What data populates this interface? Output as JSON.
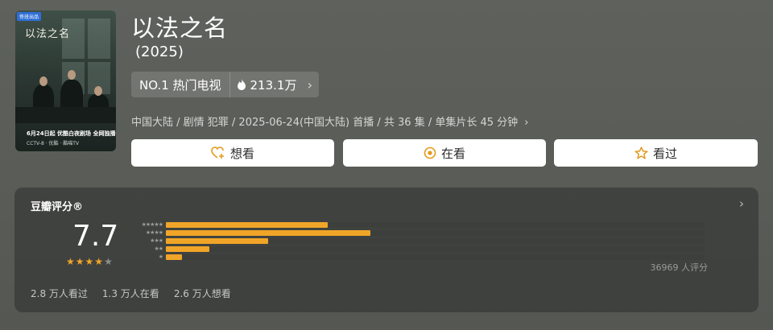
{
  "poster": {
    "badge": "佟班出品",
    "title": "以法之名",
    "air_date": "6月24日起 优酷白夜剧场 全网独播",
    "platforms": "CCTV-8 · 优酷 · 酷喵TV"
  },
  "show": {
    "title": "以法之名",
    "year": "(2025)"
  },
  "rank": {
    "label": "NO.1 热门电视",
    "heat": "213.1万"
  },
  "meta": "中国大陆 / 剧情 犯罪 / 2025-06-24(中国大陆) 首播 / 共 36 集 / 单集片长 45 分钟",
  "actions": {
    "want": "想看",
    "watching": "在看",
    "watched": "看过"
  },
  "rating": {
    "heading": "豆瓣评分®",
    "score": "7.7",
    "stars_filled": 4,
    "stars_total": 5,
    "distribution": [
      {
        "stars": "★★★★★",
        "fraction": 0.3
      },
      {
        "stars": "★★★★",
        "fraction": 0.38
      },
      {
        "stars": "★★★",
        "fraction": 0.19
      },
      {
        "stars": "★★",
        "fraction": 0.08
      },
      {
        "stars": "★",
        "fraction": 0.03
      }
    ],
    "count": "36969 人评分",
    "watched": "2.8 万人看过",
    "watching": "1.3 万人在看",
    "want": "2.6 万人想看"
  },
  "colors": {
    "accent": "#f1a528",
    "background": "#5b5e59"
  }
}
